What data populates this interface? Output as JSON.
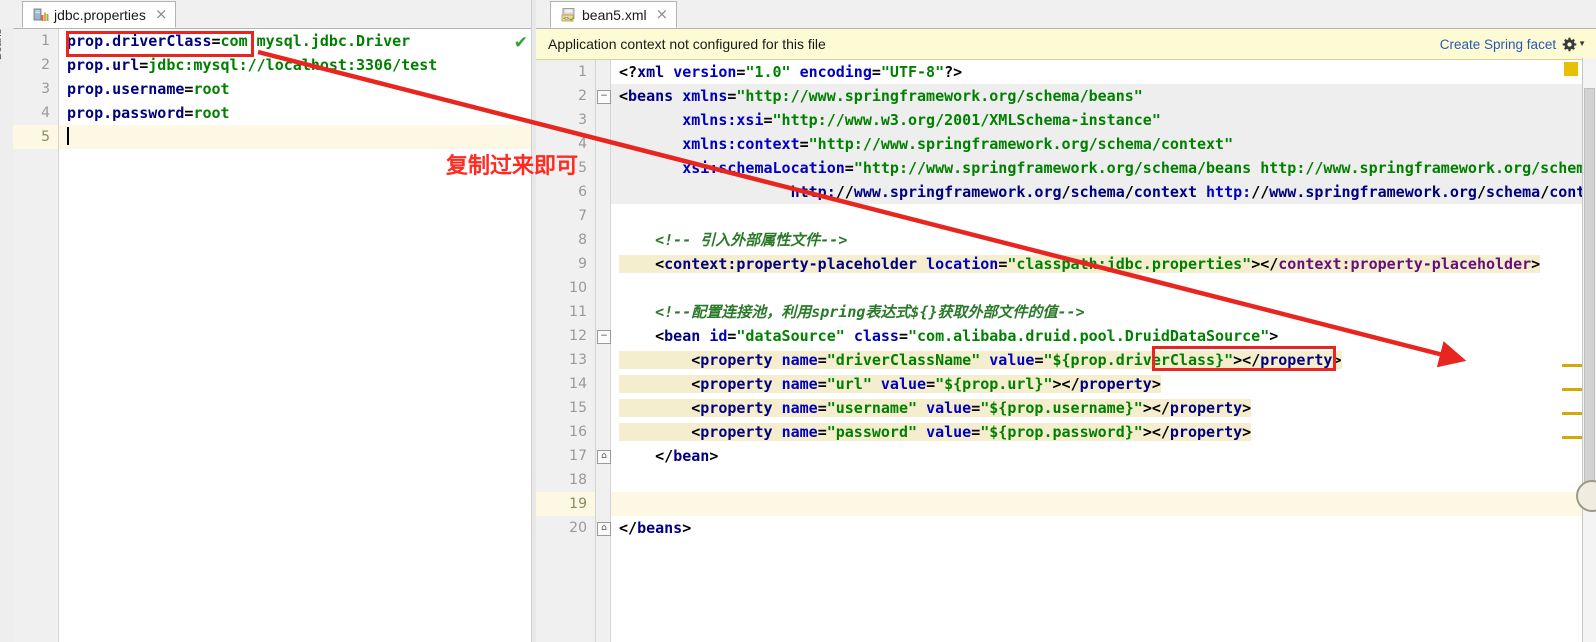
{
  "left_editor": {
    "tab": {
      "label": "jdbc.properties",
      "close": "×",
      "icon": "properties-file-icon"
    },
    "status_check": "✔",
    "line_numbers": [
      "1",
      "2",
      "3",
      "4",
      "5"
    ],
    "current_line": 5,
    "lines": [
      {
        "n": "1",
        "tokens": [
          {
            "t": "prop.driverClass",
            "c": "t-key"
          },
          {
            "t": "=",
            "c": "t-punct"
          },
          {
            "t": "com.mysql.jdbc.Driver",
            "c": "t-str"
          }
        ]
      },
      {
        "n": "2",
        "tokens": [
          {
            "t": "prop.url",
            "c": "t-key"
          },
          {
            "t": "=",
            "c": "t-punct"
          },
          {
            "t": "jdbc:mysql://localhost:3306/test",
            "c": "t-str"
          }
        ]
      },
      {
        "n": "3",
        "tokens": [
          {
            "t": "prop.username",
            "c": "t-key"
          },
          {
            "t": "=",
            "c": "t-punct"
          },
          {
            "t": "root",
            "c": "t-str"
          }
        ]
      },
      {
        "n": "4",
        "tokens": [
          {
            "t": "prop.password",
            "c": "t-key"
          },
          {
            "t": "=",
            "c": "t-punct"
          },
          {
            "t": "root",
            "c": "t-str"
          }
        ]
      },
      {
        "n": "5",
        "tokens": []
      }
    ]
  },
  "right_editor": {
    "tab": {
      "label": "bean5.xml",
      "close": "×",
      "icon": "xml-spring-file-icon"
    },
    "banner": {
      "message": "Application context not configured for this file",
      "link": "Create Spring facet",
      "gear_icon": "gear-icon",
      "caret_icon": "chevron-down-icon"
    },
    "line_numbers": [
      "1",
      "2",
      "3",
      "4",
      "5",
      "6",
      "7",
      "8",
      "9",
      "10",
      "11",
      "12",
      "13",
      "14",
      "15",
      "16",
      "17",
      "18",
      "19",
      "20"
    ],
    "current_line": 19,
    "code_lines": [
      "<?xml version=\"1.0\" encoding=\"UTF-8\"?>",
      "<beans xmlns=\"http://www.springframework.org/schema/beans\"",
      "       xmlns:xsi=\"http://www.w3.org/2001/XMLSchema-instance\"",
      "       xmlns:context=\"http://www.springframework.org/schema/context\"",
      "       xsi:schemaLocation=\"http://www.springframework.org/schema/beans http://www.springframework.org/schema/beans/spring-beans.xsd",
      "                   http://www.springframework.org/schema/context http://www.springframework.org/schema/context/spring-context.xsd\">",
      "",
      "    <!-- 引入外部属性文件-->",
      "    <context:property-placeholder location=\"classpath:jdbc.properties\"></context:property-placeholder>",
      "",
      "    <!--配置连接池，利用spring表达式${}获取外部文件的值-->",
      "    <bean id=\"dataSource\" class=\"com.alibaba.druid.pool.DruidDataSource\">",
      "        <property name=\"driverClassName\" value=\"${prop.driverClass}\"></property>",
      "        <property name=\"url\" value=\"${prop.url}\"></property>",
      "        <property name=\"username\" value=\"${prop.username}\"></property>",
      "        <property name=\"password\" value=\"${prop.password}\"></property>",
      "    </bean>",
      "",
      "",
      "</beans>"
    ],
    "fold_markers": [
      {
        "line": 2,
        "glyph": "−",
        "type": "fold-expanded-icon"
      },
      {
        "line": 12,
        "glyph": "−",
        "type": "fold-expanded-icon"
      },
      {
        "line": 17,
        "glyph": "⌂",
        "type": "fold-end-icon"
      },
      {
        "line": 20,
        "glyph": "⌂",
        "type": "fold-end-icon"
      }
    ],
    "markers": {
      "top_square_color": "#e8c000",
      "warning_line_color": "#d2aa06",
      "warning_count": 4
    }
  },
  "annotations": {
    "note_text": "复制过来即可",
    "arrow_color": "#e8251f",
    "box_color": "#e8251f",
    "source_box_label": "prop.driverClass",
    "target_box_label": "prop.driverClass"
  }
}
